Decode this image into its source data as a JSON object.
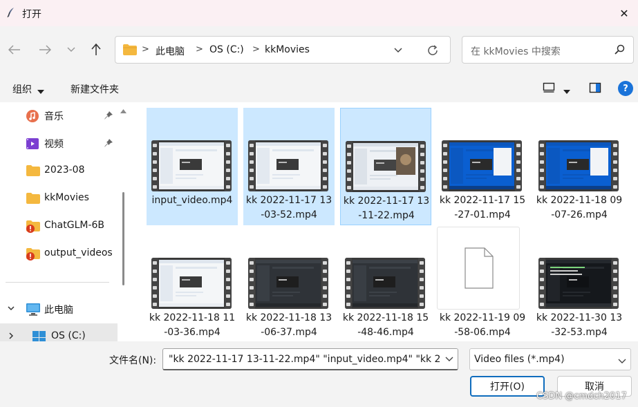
{
  "window": {
    "title": "打开",
    "close_label": "✕"
  },
  "nav": {
    "path": [
      "此电脑",
      "OS (C:)",
      "kkMovies"
    ],
    "separator": ">",
    "search_placeholder": "在 kkMovies 中搜索"
  },
  "toolbar": {
    "organize": "组织",
    "new_folder": "新建文件夹",
    "help": "?"
  },
  "sidebar": {
    "quick": [
      {
        "label": "音乐",
        "icon": "music-icon",
        "pinned": true
      },
      {
        "label": "视频",
        "icon": "video-icon",
        "pinned": true
      },
      {
        "label": "2023-08",
        "icon": "folder-icon",
        "pinned": false
      },
      {
        "label": "kkMovies",
        "icon": "folder-icon",
        "pinned": false
      },
      {
        "label": "ChatGLM-6B",
        "icon": "folder-warning-icon",
        "pinned": false
      },
      {
        "label": "output_videos",
        "icon": "folder-warning-icon",
        "pinned": false
      }
    ],
    "tree": [
      {
        "label": "此电脑",
        "icon": "computer-icon",
        "expanded": true
      },
      {
        "label": "OS (C:)",
        "icon": "drive-icon",
        "expanded": false
      }
    ]
  },
  "files": [
    {
      "name": "input_video.mp4",
      "selected": true,
      "kind": "video",
      "theme": "light"
    },
    {
      "name": "kk 2022-11-17 13-03-52.mp4",
      "selected": true,
      "kind": "video",
      "theme": "light"
    },
    {
      "name": "kk 2022-11-17 13-11-22.mp4",
      "selected": true,
      "focused": true,
      "kind": "video",
      "theme": "photo"
    },
    {
      "name": "kk 2022-11-17 15-27-01.mp4",
      "selected": false,
      "kind": "video",
      "theme": "blue"
    },
    {
      "name": "kk 2022-11-18 09-07-26.mp4",
      "selected": false,
      "kind": "video",
      "theme": "blue"
    },
    {
      "name": "kk 2022-11-18 11-03-36.mp4",
      "selected": false,
      "kind": "video",
      "theme": "light"
    },
    {
      "name": "kk 2022-11-18 13-06-37.mp4",
      "selected": false,
      "kind": "video",
      "theme": "dark"
    },
    {
      "name": "kk 2022-11-18 15-48-46.mp4",
      "selected": false,
      "kind": "video",
      "theme": "dark"
    },
    {
      "name": "kk 2022-11-19 09-58-06.mp4",
      "selected": false,
      "kind": "blank"
    },
    {
      "name": "kk 2022-11-30 13-32-53.mp4",
      "selected": false,
      "kind": "video",
      "theme": "terminal"
    }
  ],
  "footer": {
    "filename_label": "文件名(N):",
    "filename_value": "\"kk 2022-11-17 13-11-22.mp4\" \"input_video.mp4\" \"kk 2",
    "filetype": "Video files (*.mp4)",
    "open": "打开(O)",
    "cancel": "取消"
  },
  "watermark": "CSDN @cmdch2017",
  "colors": {
    "accent": "#0f6cbd",
    "selection": "#cce8ff",
    "folder": "#f4b83f"
  }
}
